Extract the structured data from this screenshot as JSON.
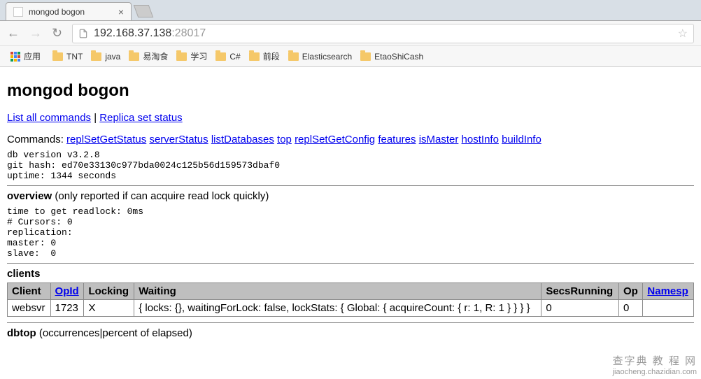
{
  "chrome": {
    "tab_title": "mongod bogon",
    "url_host": "192.168.37.138",
    "url_port": ":28017",
    "apps_label": "应用",
    "bookmarks": [
      "TNT",
      "java",
      "易淘食",
      "学习",
      "C#",
      "前段",
      "Elasticsearch",
      "EtaoShiCash"
    ]
  },
  "page": {
    "title": "mongod bogon",
    "top_links": {
      "list_all": "List all commands",
      "separator": " | ",
      "replica": "Replica set status"
    },
    "commands_label": "Commands: ",
    "commands": [
      "replSetGetStatus",
      "serverStatus",
      "listDatabases",
      "top",
      "replSetGetConfig",
      "features",
      "isMaster",
      "hostInfo",
      "buildInfo"
    ],
    "version_block": "db version v3.2.8\ngit hash: ed70e33130c977bda0024c125b56d159573dbaf0\nuptime: 1344 seconds",
    "overview": {
      "label": "overview",
      "desc": " (only reported if can acquire read lock quickly)",
      "body": "time to get readlock: 0ms\n# Cursors: 0\nreplication:\nmaster: 0\nslave:  0"
    },
    "clients": {
      "label": "clients",
      "headers": {
        "client": "Client",
        "opid": "OpId",
        "locking": "Locking",
        "waiting": "Waiting",
        "secs": "SecsRunning",
        "op": "Op",
        "ns": "Namesp"
      },
      "rows": [
        {
          "client": "websvr",
          "opid": "1723",
          "locking": "X",
          "waiting": "{ locks: {}, waitingForLock: false, lockStats: { Global: { acquireCount: { r: 1, R: 1 } } } }",
          "secs": "0",
          "op": "0",
          "ns": ""
        }
      ]
    },
    "dbtop": {
      "label": "dbtop",
      "desc": " (occurrences|percent of elapsed)"
    }
  },
  "watermark": {
    "line1": "查字典 教 程 网",
    "line2": "jiaocheng.chazidian.com"
  }
}
